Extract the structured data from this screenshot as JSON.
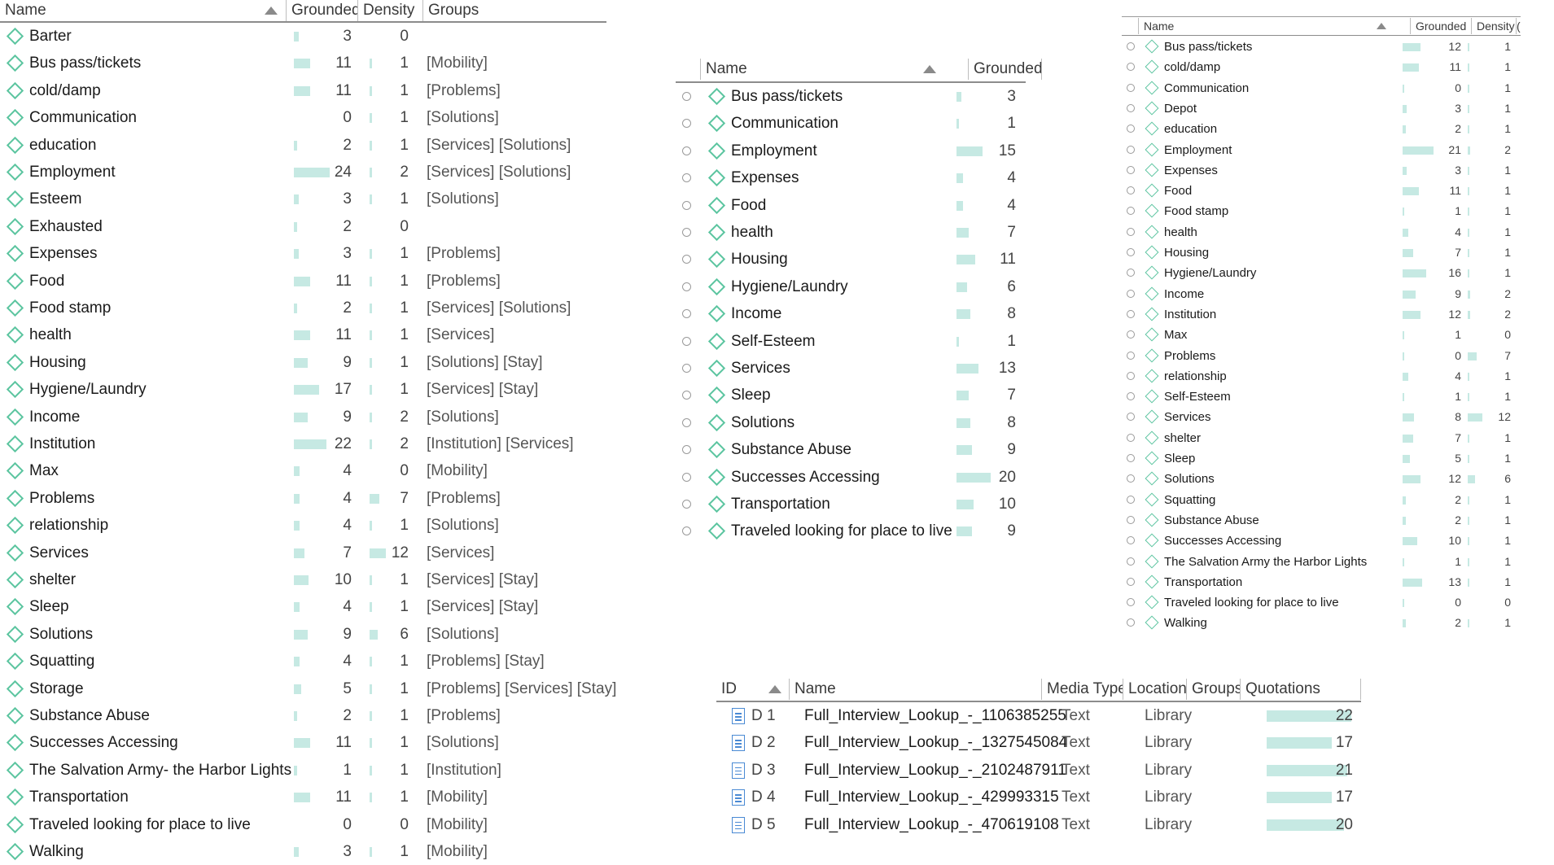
{
  "codes_table": {
    "columns": [
      "Name",
      "Grounded",
      "Density",
      "Groups"
    ],
    "rows": [
      {
        "name": "Barter",
        "grounded": "3",
        "density": "0",
        "groups": ""
      },
      {
        "name": "Bus pass/tickets",
        "grounded": "11",
        "density": "1",
        "groups": "[Mobility]"
      },
      {
        "name": "cold/damp",
        "grounded": "11",
        "density": "1",
        "groups": "[Problems]"
      },
      {
        "name": "Communication",
        "grounded": "0",
        "density": "1",
        "groups": "[Solutions]"
      },
      {
        "name": "education",
        "grounded": "2",
        "density": "1",
        "groups": "[Services] [Solutions]"
      },
      {
        "name": "Employment",
        "grounded": "24",
        "density": "2",
        "groups": "[Services] [Solutions]"
      },
      {
        "name": "Esteem",
        "grounded": "3",
        "density": "1",
        "groups": "[Solutions]"
      },
      {
        "name": "Exhausted",
        "grounded": "2",
        "density": "0",
        "groups": ""
      },
      {
        "name": "Expenses",
        "grounded": "3",
        "density": "1",
        "groups": "[Problems]"
      },
      {
        "name": "Food",
        "grounded": "11",
        "density": "1",
        "groups": "[Problems]"
      },
      {
        "name": "Food stamp",
        "grounded": "2",
        "density": "1",
        "groups": "[Services] [Solutions]"
      },
      {
        "name": "health",
        "grounded": "11",
        "density": "1",
        "groups": "[Services]"
      },
      {
        "name": "Housing",
        "grounded": "9",
        "density": "1",
        "groups": "[Solutions] [Stay]"
      },
      {
        "name": "Hygiene/Laundry",
        "grounded": "17",
        "density": "1",
        "groups": "[Services] [Stay]"
      },
      {
        "name": "Income",
        "grounded": "9",
        "density": "2",
        "groups": "[Solutions]"
      },
      {
        "name": "Institution",
        "grounded": "22",
        "density": "2",
        "groups": "[Institution] [Services]"
      },
      {
        "name": "Max",
        "grounded": "4",
        "density": "0",
        "groups": "[Mobility]"
      },
      {
        "name": "Problems",
        "grounded": "4",
        "density": "7",
        "groups": "[Problems]"
      },
      {
        "name": "relationship",
        "grounded": "4",
        "density": "1",
        "groups": "[Solutions]"
      },
      {
        "name": "Services",
        "grounded": "7",
        "density": "12",
        "groups": "[Services]"
      },
      {
        "name": "shelter",
        "grounded": "10",
        "density": "1",
        "groups": "[Services] [Stay]"
      },
      {
        "name": "Sleep",
        "grounded": "4",
        "density": "1",
        "groups": "[Services] [Stay]"
      },
      {
        "name": "Solutions",
        "grounded": "9",
        "density": "6",
        "groups": "[Solutions]"
      },
      {
        "name": "Squatting",
        "grounded": "4",
        "density": "1",
        "groups": "[Problems] [Stay]"
      },
      {
        "name": "Storage",
        "grounded": "5",
        "density": "1",
        "groups": "[Problems] [Services] [Stay]"
      },
      {
        "name": "Substance Abuse",
        "grounded": "2",
        "density": "1",
        "groups": "[Problems]"
      },
      {
        "name": "Successes Accessing",
        "grounded": "11",
        "density": "1",
        "groups": "[Solutions]"
      },
      {
        "name": "The Salvation Army- the Harbor Lights",
        "grounded": "1",
        "density": "1",
        "groups": "[Institution]"
      },
      {
        "name": "Transportation",
        "grounded": "11",
        "density": "1",
        "groups": "[Mobility]"
      },
      {
        "name": "Traveled looking for place to live",
        "grounded": "0",
        "density": "0",
        "groups": "[Mobility]"
      },
      {
        "name": "Walking",
        "grounded": "3",
        "density": "1",
        "groups": "[Mobility]"
      }
    ]
  },
  "middle_table": {
    "columns": [
      "Name",
      "Grounded"
    ],
    "rows": [
      {
        "name": "Bus pass/tickets",
        "grounded": "3"
      },
      {
        "name": "Communication",
        "grounded": "1"
      },
      {
        "name": "Employment",
        "grounded": "15"
      },
      {
        "name": "Expenses",
        "grounded": "4"
      },
      {
        "name": "Food",
        "grounded": "4"
      },
      {
        "name": "health",
        "grounded": "7"
      },
      {
        "name": "Housing",
        "grounded": "11"
      },
      {
        "name": "Hygiene/Laundry",
        "grounded": "6"
      },
      {
        "name": "Income",
        "grounded": "8"
      },
      {
        "name": "Self-Esteem",
        "grounded": "1"
      },
      {
        "name": "Services",
        "grounded": "13"
      },
      {
        "name": "Sleep",
        "grounded": "7"
      },
      {
        "name": "Solutions",
        "grounded": "8"
      },
      {
        "name": "Substance Abuse",
        "grounded": "9"
      },
      {
        "name": "Successes Accessing",
        "grounded": "20"
      },
      {
        "name": "Transportation",
        "grounded": "10"
      },
      {
        "name": "Traveled looking for place to live",
        "grounded": "9"
      }
    ]
  },
  "right_table": {
    "columns": [
      "Name",
      "Grounded",
      "Density",
      "("
    ],
    "rows": [
      {
        "name": "Bus pass/tickets",
        "grounded": "12",
        "density": "1"
      },
      {
        "name": "cold/damp",
        "grounded": "11",
        "density": "1"
      },
      {
        "name": "Communication",
        "grounded": "0",
        "density": "1"
      },
      {
        "name": "Depot",
        "grounded": "3",
        "density": "1"
      },
      {
        "name": "education",
        "grounded": "2",
        "density": "1"
      },
      {
        "name": "Employment",
        "grounded": "21",
        "density": "2"
      },
      {
        "name": "Expenses",
        "grounded": "3",
        "density": "1"
      },
      {
        "name": "Food",
        "grounded": "11",
        "density": "1"
      },
      {
        "name": "Food stamp",
        "grounded": "1",
        "density": "1"
      },
      {
        "name": "health",
        "grounded": "4",
        "density": "1"
      },
      {
        "name": "Housing",
        "grounded": "7",
        "density": "1"
      },
      {
        "name": "Hygiene/Laundry",
        "grounded": "16",
        "density": "1"
      },
      {
        "name": "Income",
        "grounded": "9",
        "density": "2"
      },
      {
        "name": "Institution",
        "grounded": "12",
        "density": "2"
      },
      {
        "name": "Max",
        "grounded": "1",
        "density": "0"
      },
      {
        "name": "Problems",
        "grounded": "0",
        "density": "7"
      },
      {
        "name": "relationship",
        "grounded": "4",
        "density": "1"
      },
      {
        "name": "Self-Esteem",
        "grounded": "1",
        "density": "1"
      },
      {
        "name": "Services",
        "grounded": "8",
        "density": "12"
      },
      {
        "name": "shelter",
        "grounded": "7",
        "density": "1"
      },
      {
        "name": "Sleep",
        "grounded": "5",
        "density": "1"
      },
      {
        "name": "Solutions",
        "grounded": "12",
        "density": "6"
      },
      {
        "name": "Squatting",
        "grounded": "2",
        "density": "1"
      },
      {
        "name": "Substance Abuse",
        "grounded": "2",
        "density": "1"
      },
      {
        "name": "Successes Accessing",
        "grounded": "10",
        "density": "1"
      },
      {
        "name": "The Salvation Army  the Harbor Lights",
        "grounded": "1",
        "density": "1"
      },
      {
        "name": "Transportation",
        "grounded": "13",
        "density": "1"
      },
      {
        "name": "Traveled looking for place to live",
        "grounded": "0",
        "density": "0"
      },
      {
        "name": "Walking",
        "grounded": "2",
        "density": "1"
      }
    ]
  },
  "documents_table": {
    "columns": [
      "ID",
      "Name",
      "Media Type",
      "Location",
      "Groups",
      "Quotations"
    ],
    "rows": [
      {
        "id": "D 1",
        "name": "Full_Interview_Lookup_-_1106385255",
        "media": "Text",
        "location": "Library",
        "groups": "",
        "quotations": "22"
      },
      {
        "id": "D 2",
        "name": "Full_Interview_Lookup_-_1327545084",
        "media": "Text",
        "location": "Library",
        "groups": "",
        "quotations": "17"
      },
      {
        "id": "D 3",
        "name": "Full_Interview_Lookup_-_2102487911",
        "media": "Text",
        "location": "Library",
        "groups": "",
        "quotations": "21"
      },
      {
        "id": "D 4",
        "name": "Full_Interview_Lookup_-_429993315",
        "media": "Text",
        "location": "Library",
        "groups": "",
        "quotations": "17"
      },
      {
        "id": "D 5",
        "name": "Full_Interview_Lookup_-_470619108",
        "media": "Text",
        "location": "Library",
        "groups": "",
        "quotations": "20"
      }
    ]
  },
  "colors": {
    "bar": "#c6e9e3",
    "code_icon": "#5cc5a0",
    "doc_icon": "#4a8ad4"
  }
}
